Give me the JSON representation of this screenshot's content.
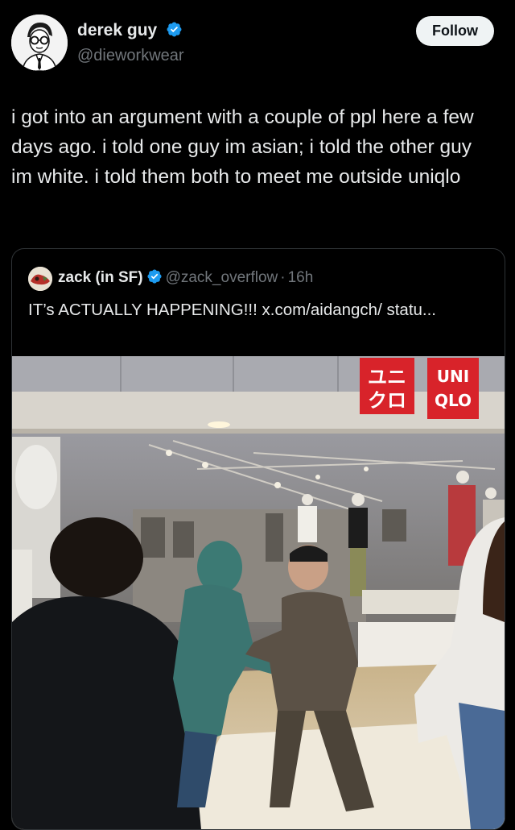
{
  "author": {
    "name": "derek guy",
    "handle": "@dieworkwear",
    "verified_icon": "verified-badge-icon"
  },
  "follow_button": {
    "label": "Follow"
  },
  "tweet": {
    "text": "i got into an argument with a couple of ppl here a few days ago. i told one guy im asian; i told the other guy im white. i told them both to meet me outside uniqlo"
  },
  "quoted_tweet": {
    "name": "zack (in SF)",
    "handle": "@zack_overflow",
    "separator": "·",
    "time": "16h",
    "text": "IT’s ACTUALLY HAPPENING!!! x.com/aidangch/ statu...",
    "media": {
      "store_sign_left": "ユニ クロ",
      "store_sign_right": "UNI QLO"
    }
  },
  "colors": {
    "background": "#000000",
    "verified_blue": "#1d9bf0",
    "uniqlo_red": "#d8232a",
    "follow_bg": "#eff3f4"
  }
}
